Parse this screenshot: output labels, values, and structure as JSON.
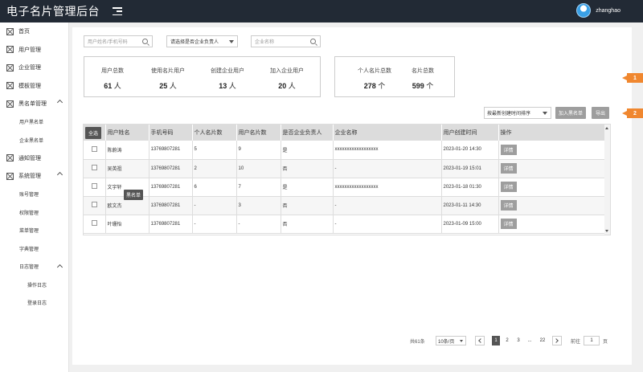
{
  "app": {
    "title": "电子名片管理后台",
    "username": "zhanghao"
  },
  "sidebar": {
    "items": [
      {
        "label": "首页"
      },
      {
        "label": "用户管理"
      },
      {
        "label": "企业管理"
      },
      {
        "label": "模板管理"
      },
      {
        "label": "黑名单管理"
      },
      {
        "label": "用户黑名单"
      },
      {
        "label": "企业黑名单"
      },
      {
        "label": "通知管理"
      },
      {
        "label": "系统管理"
      },
      {
        "label": "账号管理"
      },
      {
        "label": "权限管理"
      },
      {
        "label": "菜单管理"
      },
      {
        "label": "字典管理"
      },
      {
        "label": "日志管理"
      },
      {
        "label": "操作日志"
      },
      {
        "label": "登录日志"
      }
    ]
  },
  "filters": {
    "name_phone_placeholder": "用户姓名/手机号码",
    "principal_select": "请选择是否企业负责人",
    "company_placeholder": "企业名称"
  },
  "stats_user": [
    {
      "label": "用户总数",
      "value": "61",
      "unit": "人"
    },
    {
      "label": "使用名片用户",
      "value": "25",
      "unit": "人"
    },
    {
      "label": "创建企业用户",
      "value": "13",
      "unit": "人"
    },
    {
      "label": "加入企业用户",
      "value": "20",
      "unit": "人"
    }
  ],
  "stats_card": [
    {
      "label": "个人名片总数",
      "value": "278",
      "unit": "个"
    },
    {
      "label": "名片总数",
      "value": "599",
      "unit": "个"
    }
  ],
  "toolbar": {
    "sort_label": "按最新创建时间排序",
    "blacklist_button": "加入黑名单",
    "export_button": "导出"
  },
  "table": {
    "select_all": "全选",
    "headers": [
      "用户姓名",
      "手机号码",
      "个人名片数",
      "用户名片数",
      "是否企业负责人",
      "企业名称",
      "用户创建时间",
      "操作"
    ],
    "rows": [
      {
        "name": "陈蔚涛",
        "phone": "13769807281",
        "personal": "5",
        "user_cards": "9",
        "principal": "是",
        "company": "xxxxxxxxxxxxxxxxxx",
        "created": "2023-01-20 14:30",
        "action": "详情"
      },
      {
        "name": "吴英祖",
        "phone": "13769807281",
        "personal": "2",
        "user_cards": "10",
        "principal": "否",
        "company": "-",
        "created": "2023-01-19 15:01",
        "action": "详情"
      },
      {
        "name": "文宇轩",
        "phone": "13769807281",
        "personal": "6",
        "user_cards": "7",
        "principal": "是",
        "company": "xxxxxxxxxxxxxxxxxx",
        "created": "2023-01-18 01:30",
        "action": "详情"
      },
      {
        "name": "欧文杰",
        "phone": "13769807281",
        "personal": "-",
        "user_cards": "3",
        "principal": "否",
        "company": "-",
        "created": "2023-01-11 14:30",
        "action": "详情"
      },
      {
        "name": "叶珊怡",
        "phone": "13769807281",
        "personal": "-",
        "user_cards": "-",
        "principal": "否",
        "company": "-",
        "created": "2023-01-09 15:00",
        "action": "详情"
      }
    ],
    "blacklist_tag": "黑名单"
  },
  "pagination": {
    "total": "共61条",
    "page_size": "10条/页",
    "pages": [
      "1",
      "2",
      "3",
      "...",
      "22"
    ],
    "goto_label": "前往",
    "goto_value": "1",
    "page_suffix": "页"
  },
  "markers": [
    "1",
    "2"
  ]
}
